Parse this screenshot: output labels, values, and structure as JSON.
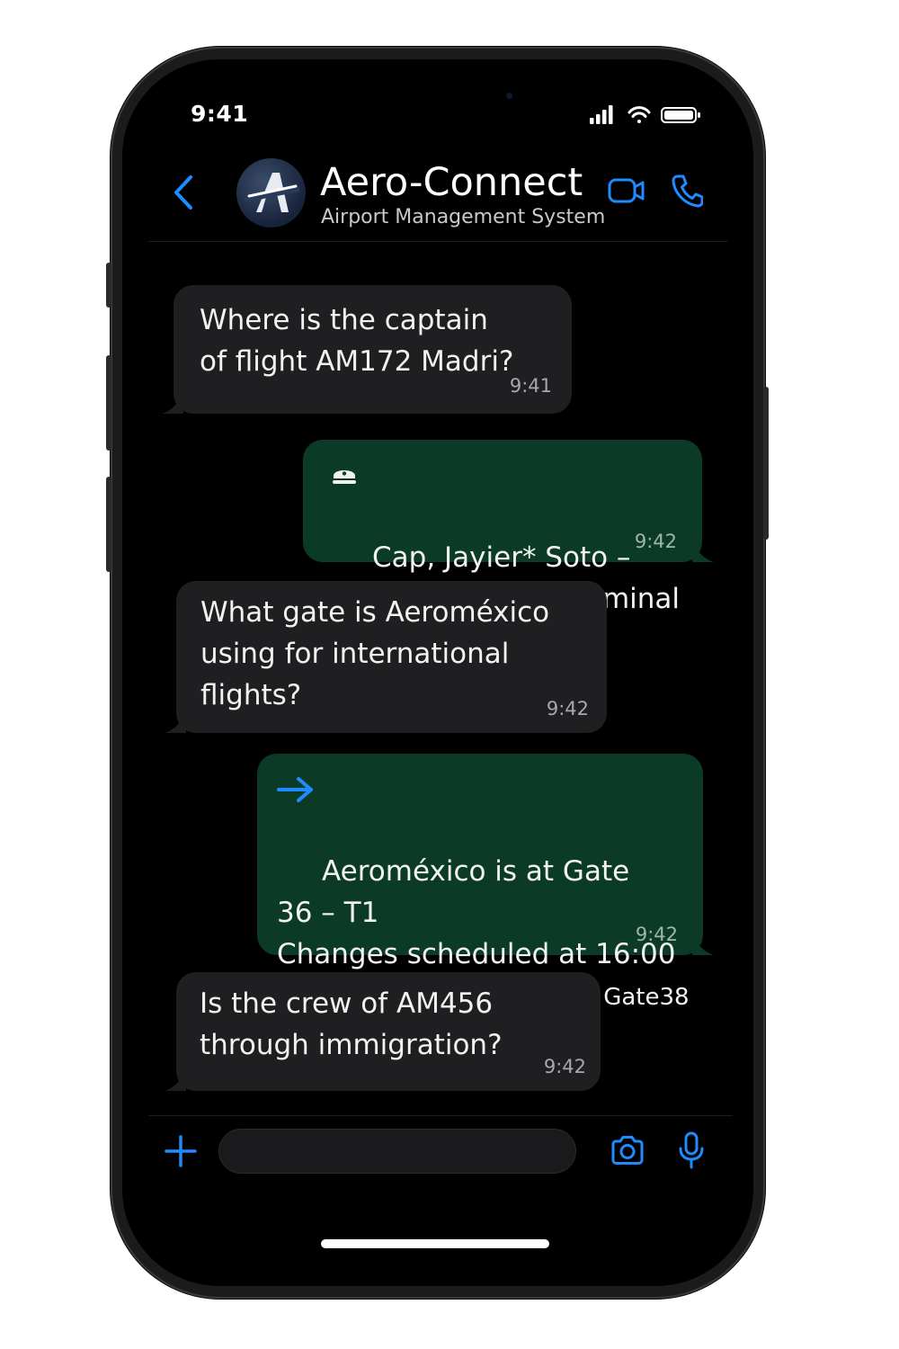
{
  "status_bar": {
    "time": "9:41"
  },
  "header": {
    "title": "Aero-Connect",
    "subtitle": "Airport Management System",
    "avatar_icon": "aero-logo-icon"
  },
  "messages": [
    {
      "direction": "incoming",
      "text": "Where is the captain\nof flight AM172 Madri?",
      "time": "9:41"
    },
    {
      "direction": "outgoing",
      "icon": "captain-hat-icon",
      "text": "Cap, Jayier* Soto –\nBreak Room B2, Terminal 1",
      "time": "9:42"
    },
    {
      "direction": "incoming",
      "text": "What gate is Aeroméxico\nusing for international\nflights?",
      "time": "9:42"
    },
    {
      "direction": "outgoing",
      "icon": "arrow-right-icon",
      "text": "Aeroméxico is at Gate\n36 – T1\nChanges scheduled at 16:00\ndue to maintenance at",
      "text_tail": "Gate38",
      "time": "9:42"
    },
    {
      "direction": "incoming",
      "text": "Is the crew of AM456\nthrough immigration?",
      "time": "9:42"
    }
  ],
  "composer": {
    "placeholder": ""
  },
  "colors": {
    "accent": "#1e8bff",
    "incoming_bubble": "#1f1f21",
    "outgoing_bubble": "#0b3a27",
    "background": "#000000"
  }
}
